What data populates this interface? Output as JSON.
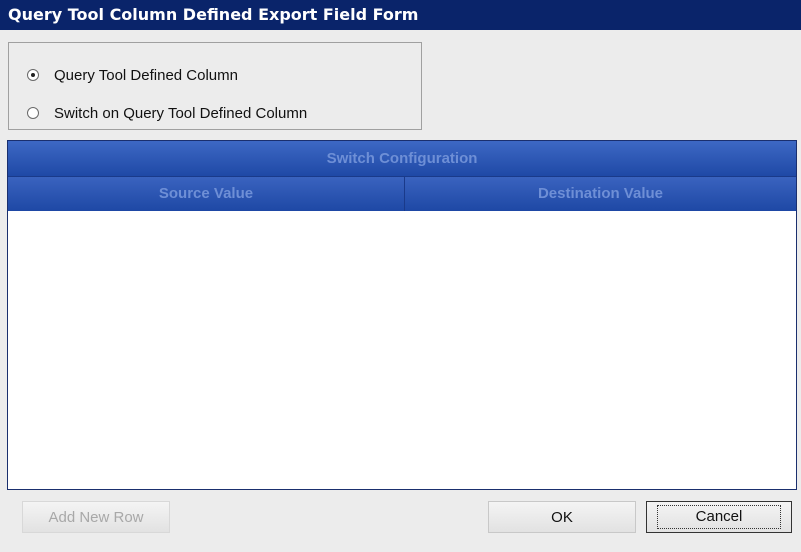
{
  "window": {
    "title": "Query Tool Column Defined Export Field Form"
  },
  "options": [
    {
      "label": "Query Tool Defined Column",
      "checked": true
    },
    {
      "label": "Switch on Query Tool Defined Column",
      "checked": false
    }
  ],
  "grid": {
    "caption": "Switch Configuration",
    "columns": [
      "Source Value",
      "Destination Value"
    ],
    "rows": []
  },
  "buttons": {
    "add_new_row": "Add New Row",
    "ok": "OK",
    "cancel": "Cancel"
  },
  "colors": {
    "titlebar": "#0a246a",
    "grid_header": "#2a55b4"
  }
}
